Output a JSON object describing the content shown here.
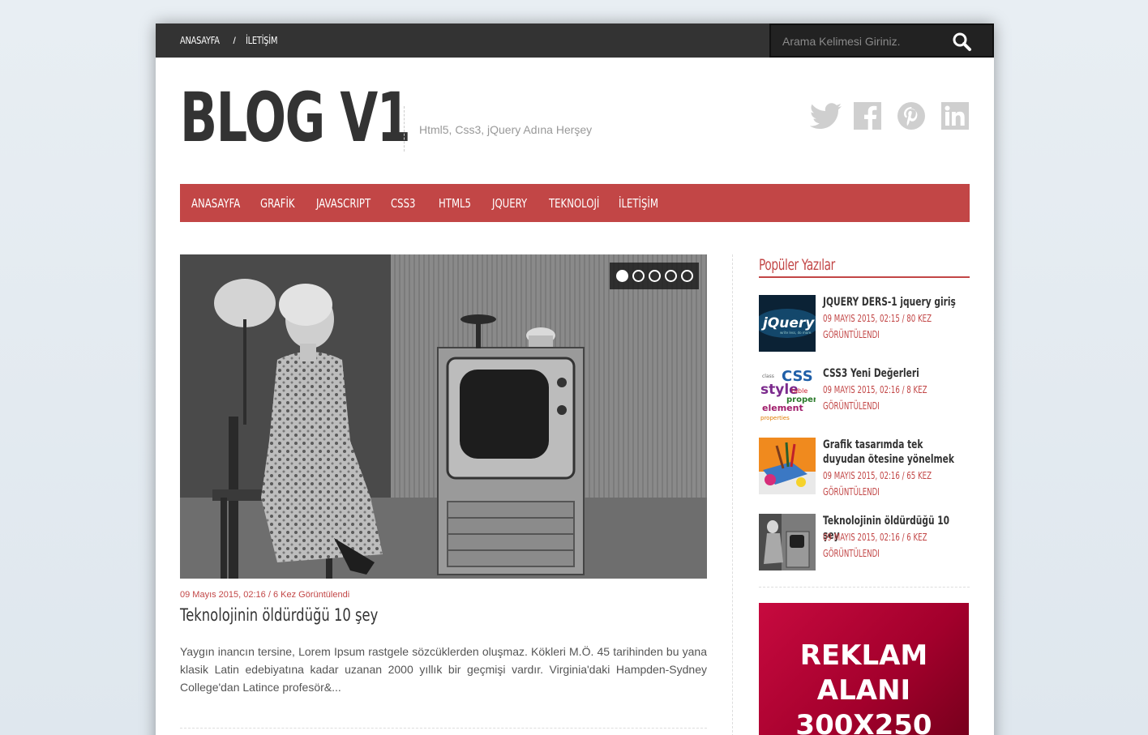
{
  "topbar": {
    "links": [
      "ANASAYFA",
      "İLETİŞİM"
    ],
    "separator": "/",
    "search_placeholder": "Arama Kelimesi Giriniz."
  },
  "header": {
    "logo": "BLOG V1",
    "tagline": "Html5, Css3, jQuery Adına Herşey",
    "social_icons": [
      "twitter-icon",
      "facebook-icon",
      "pinterest-icon",
      "linkedin-icon"
    ]
  },
  "nav": {
    "items": [
      "ANASAYFA",
      "GRAFİK",
      "JAVASCRIPT",
      "CSS3",
      "HTML5",
      "JQUERY",
      "TEKNOLOJİ",
      "İLETİŞİM"
    ]
  },
  "slider": {
    "slide_count": 5,
    "active_index": 0
  },
  "featured_post": {
    "meta": "09 Mayıs 2015, 02:16 / 6 Kez Görüntülendi",
    "title": "Teknolojinin öldürdüğü 10 şey",
    "excerpt": "Yaygın inancın tersine, Lorem Ipsum rastgele sözcüklerden oluşmaz. Kökleri M.Ö. 45 tarihinden bu yana klasik Latin edebiyatına kadar uzanan 2000 yıllık bir geçmişi vardır. Virginia'daki Hampden-Sydney College'dan Latince profesör&..."
  },
  "sidebar": {
    "title": "Popüler Yazılar",
    "posts": [
      {
        "title": "JQUERY DERS-1 jquery giriş",
        "meta": "09 Mayıs 2015, 02:15 / 80 Kez Görüntülendi",
        "thumb": "jquery"
      },
      {
        "title": "CSS3 Yeni Değerleri",
        "meta": "09 Mayıs 2015, 02:16 / 8 Kez Görüntülendi",
        "thumb": "css"
      },
      {
        "title": "Grafik tasarımda tek duyudan ötesine yönelmek",
        "meta": "09 Mayıs 2015, 02:16 / 65 Kez Görüntülendi",
        "thumb": "grafik"
      },
      {
        "title": "Teknolojinin öldürdüğü 10 şey",
        "meta": "09 Mayıs 2015, 02:16 / 6 Kez Görüntülendi",
        "thumb": "tv"
      }
    ],
    "ad_text": "REKLAM\nALANI\n300X250"
  },
  "colors": {
    "accent": "#c24646",
    "topbar": "#333333",
    "ad_bg": "#b3002f"
  }
}
